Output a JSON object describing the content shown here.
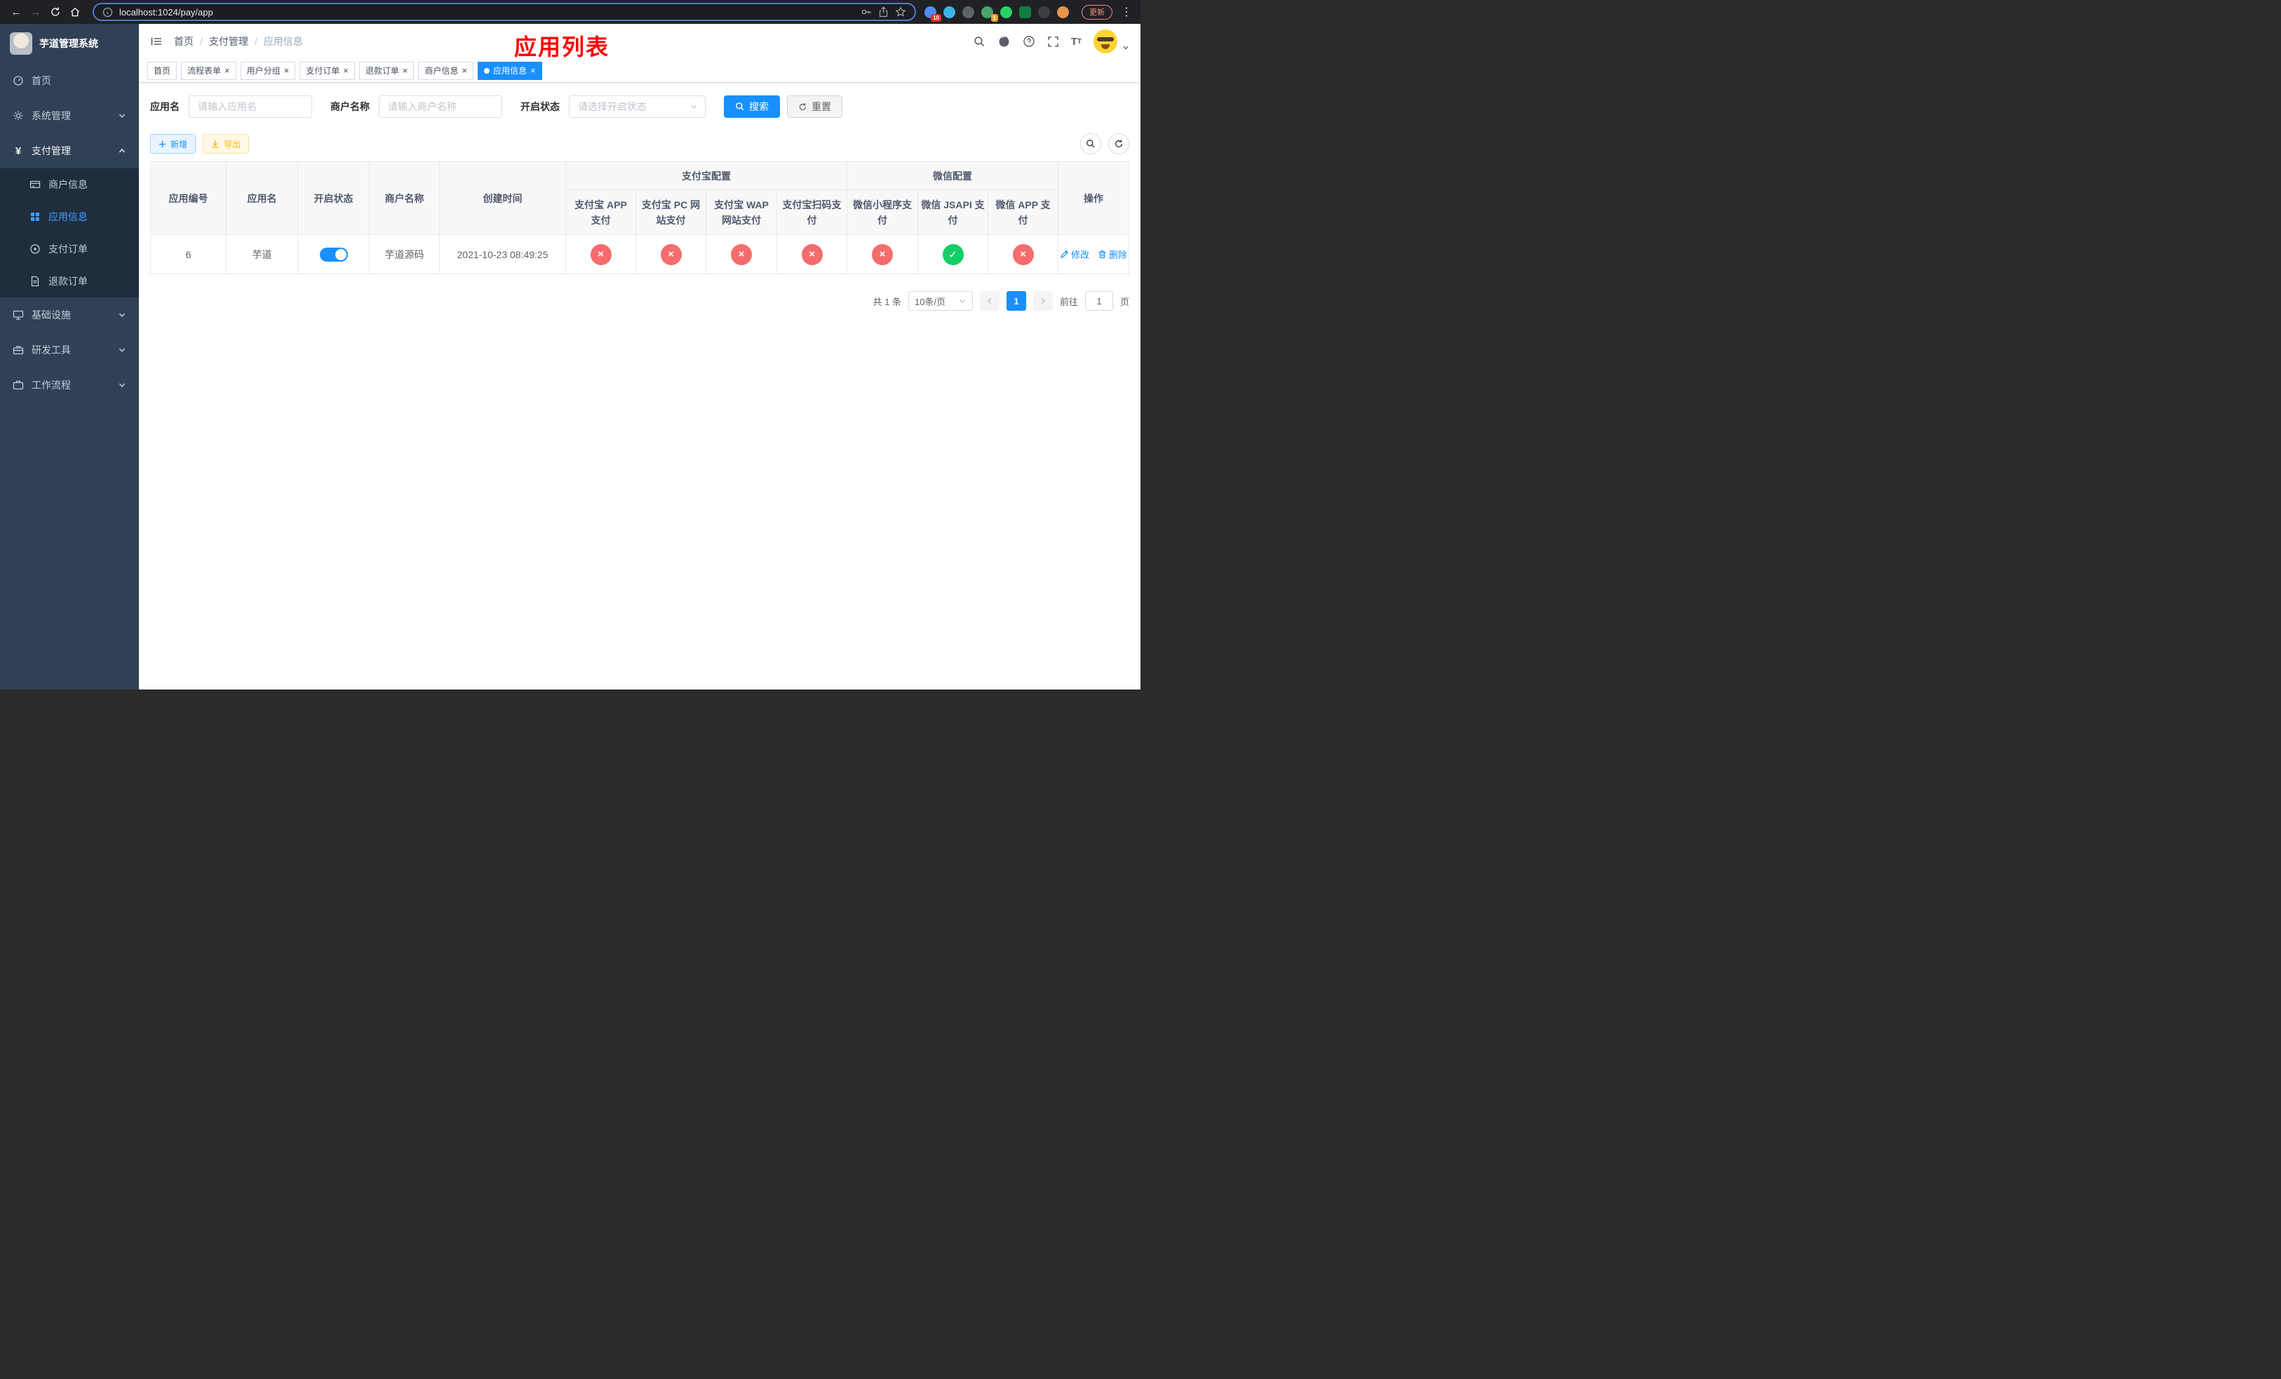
{
  "browser": {
    "url": "localhost:1024/pay/app",
    "update_label": "更新",
    "badge_1": "10",
    "badge_2": "1"
  },
  "sidebar": {
    "logo_title": "芋道管理系统",
    "menu_home": "首页",
    "menu_system": "系统管理",
    "menu_payment": "支付管理",
    "menu_merchant": "商户信息",
    "menu_app": "应用信息",
    "menu_pay_order": "支付订单",
    "menu_refund_order": "退款订单",
    "menu_infra": "基础设施",
    "menu_dev": "研发工具",
    "menu_workflow": "工作流程"
  },
  "header": {
    "breadcrumb_home": "首页",
    "breadcrumb_section": "支付管理",
    "breadcrumb_current": "应用信息",
    "page_title": "应用列表"
  },
  "tabs": {
    "items": [
      {
        "label": "首页"
      },
      {
        "label": "流程表单"
      },
      {
        "label": "用户分组"
      },
      {
        "label": "支付订单"
      },
      {
        "label": "退款订单"
      },
      {
        "label": "商户信息"
      },
      {
        "label": "应用信息"
      }
    ]
  },
  "filters": {
    "app_name_label": "应用名",
    "app_name_placeholder": "请输入应用名",
    "merchant_label": "商户名称",
    "merchant_placeholder": "请输入商户名称",
    "status_label": "开启状态",
    "status_placeholder": "请选择开启状态",
    "search_label": "搜索",
    "reset_label": "重置"
  },
  "toolbar": {
    "add_label": "新增",
    "export_label": "导出"
  },
  "table": {
    "columns": {
      "app_id": "应用编号",
      "app_name": "应用名",
      "status": "开启状态",
      "merchant_name": "商户名称",
      "create_time": "创建时间",
      "alipay_group": "支付宝配置",
      "wechat_group": "微信配置",
      "alipay_app": "支付宝 APP 支付",
      "alipay_pc": "支付宝 PC 网站支付",
      "alipay_wap": "支付宝 WAP 网站支付",
      "alipay_qr": "支付宝扫码支付",
      "wechat_lite": "微信小程序支付",
      "wechat_jsapi": "微信 JSAPI 支付",
      "wechat_app": "微信 APP 支付",
      "actions": "操作"
    },
    "row": {
      "app_id": "6",
      "app_name": "芋道",
      "enabled": true,
      "merchant_name": "芋道源码",
      "create_time": "2021-10-23 08:49:25",
      "configs": {
        "alipay_app": false,
        "alipay_pc": false,
        "alipay_wap": false,
        "alipay_qr": false,
        "wechat_lite": false,
        "wechat_jsapi": true,
        "wechat_app": false
      },
      "edit_label": "修改",
      "delete_label": "删除"
    }
  },
  "pagination": {
    "total": "共 1 条",
    "page_size": "10条/页",
    "page": "1",
    "goto_label": "前往",
    "goto_value": "1",
    "unit": "页"
  },
  "colors": {
    "primary": "#1890ff",
    "success": "#13ce66",
    "danger": "#f56c6c",
    "sidebar_bg": "#304156",
    "submenu_bg": "#1f2d3d",
    "title_red": "#ff0000"
  }
}
